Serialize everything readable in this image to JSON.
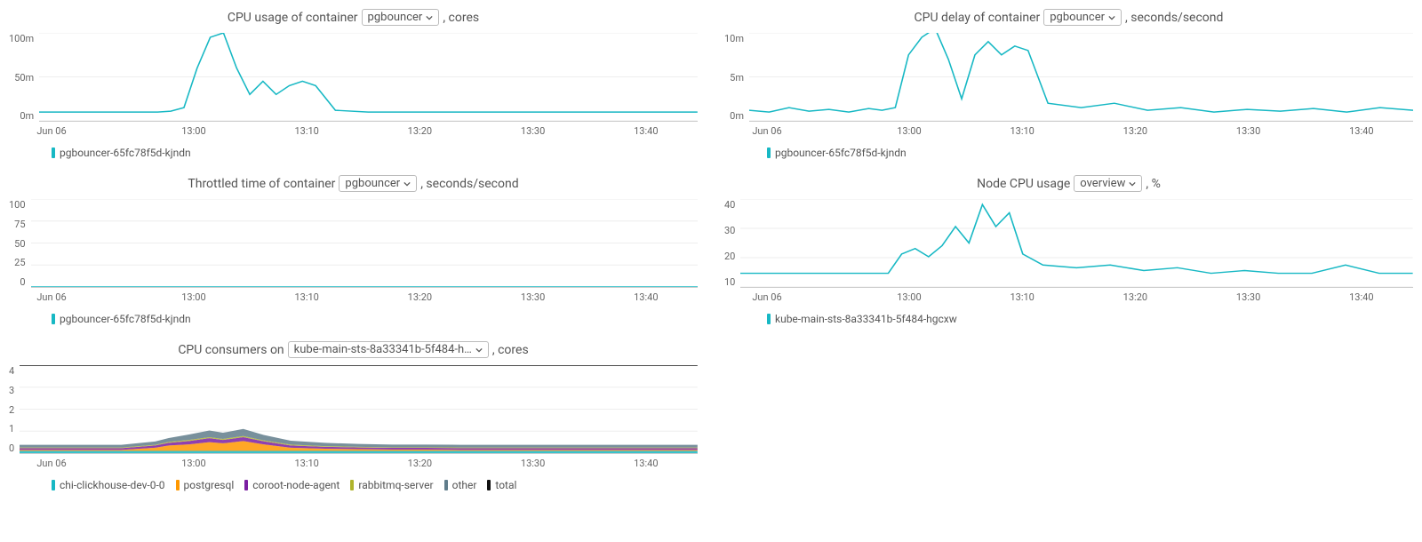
{
  "xticks": [
    "Jun 06",
    "13:00",
    "13:10",
    "13:20",
    "13:30",
    "13:40"
  ],
  "xpositions": [
    0,
    0.22,
    0.395,
    0.57,
    0.745,
    0.92
  ],
  "colors": {
    "teal": "#17b8c4",
    "orange": "#ff9800",
    "purple": "#7b1fa2",
    "olive": "#afb42b",
    "bluegrey": "#607d8b",
    "black": "#111111"
  },
  "panels": [
    {
      "id": "cpu-usage",
      "title_pre": "CPU usage of container",
      "dropdown": "pgbouncer",
      "title_post": ", cores",
      "yticks": [
        "100m",
        "50m",
        "0m"
      ],
      "ymax": 100,
      "legend": [
        {
          "color": "teal",
          "label": "pgbouncer-65fc78f5d-kjndn"
        }
      ]
    },
    {
      "id": "cpu-delay",
      "title_pre": "CPU delay of container",
      "dropdown": "pgbouncer",
      "title_post": ", seconds/second",
      "yticks": [
        "10m",
        "5m",
        "0m"
      ],
      "ymax": 10,
      "legend": [
        {
          "color": "teal",
          "label": "pgbouncer-65fc78f5d-kjndn"
        }
      ]
    },
    {
      "id": "throttled",
      "title_pre": "Throttled time of container",
      "dropdown": "pgbouncer",
      "title_post": ", seconds/second",
      "yticks": [
        "100",
        "75",
        "50",
        "25",
        "0"
      ],
      "ymax": 100,
      "legend": [
        {
          "color": "teal",
          "label": "pgbouncer-65fc78f5d-kjndn"
        }
      ]
    },
    {
      "id": "node-cpu",
      "title_pre": "Node CPU usage",
      "dropdown": "overview",
      "title_post": ", %",
      "yticks": [
        "40",
        "30",
        "20",
        "10"
      ],
      "ymax": 40,
      "ymin": 8,
      "legend": [
        {
          "color": "teal",
          "label": "kube-main-sts-8a33341b-5f484-hgcxw"
        }
      ]
    },
    {
      "id": "consumers",
      "title_pre": "CPU consumers on",
      "dropdown": "kube-main-sts-8a33341b-5f484-h…",
      "title_post": ", cores",
      "yticks": [
        "4",
        "3",
        "2",
        "1",
        "0"
      ],
      "ymax": 4,
      "legend": [
        {
          "color": "teal",
          "label": "chi-clickhouse-dev-0-0"
        },
        {
          "color": "orange",
          "label": "postgresql"
        },
        {
          "color": "purple",
          "label": "coroot-node-agent"
        },
        {
          "color": "olive",
          "label": "rabbitmq-server"
        },
        {
          "color": "bluegrey",
          "label": "other"
        },
        {
          "color": "black",
          "label": "total"
        }
      ]
    }
  ],
  "chart_data": [
    {
      "panel": "cpu-usage",
      "type": "line",
      "xlabel": "",
      "ylabel": "cores",
      "title": "CPU usage of container pgbouncer, cores",
      "ylim": [
        0,
        100
      ],
      "x": [
        0.0,
        0.05,
        0.1,
        0.15,
        0.18,
        0.2,
        0.22,
        0.24,
        0.26,
        0.28,
        0.3,
        0.32,
        0.34,
        0.36,
        0.38,
        0.4,
        0.42,
        0.45,
        0.5,
        0.55,
        0.6,
        0.65,
        0.7,
        0.75,
        0.8,
        0.85,
        0.9,
        0.95,
        1.0
      ],
      "series": [
        {
          "name": "pgbouncer-65fc78f5d-kjndn",
          "values": [
            10,
            10,
            10,
            10,
            10,
            11,
            15,
            60,
            95,
            100,
            60,
            30,
            45,
            30,
            40,
            45,
            40,
            12,
            10,
            10,
            10,
            10,
            10,
            10,
            10,
            10,
            10,
            10,
            10
          ]
        }
      ]
    },
    {
      "panel": "cpu-delay",
      "type": "line",
      "title": "CPU delay of container pgbouncer, seconds/second",
      "ylim": [
        0,
        10
      ],
      "x": [
        0.0,
        0.03,
        0.06,
        0.09,
        0.12,
        0.15,
        0.18,
        0.2,
        0.22,
        0.24,
        0.26,
        0.28,
        0.3,
        0.32,
        0.34,
        0.36,
        0.38,
        0.4,
        0.42,
        0.45,
        0.5,
        0.55,
        0.6,
        0.65,
        0.7,
        0.75,
        0.8,
        0.85,
        0.9,
        0.95,
        1.0
      ],
      "series": [
        {
          "name": "pgbouncer-65fc78f5d-kjndn",
          "values": [
            1.2,
            1.0,
            1.5,
            1.1,
            1.3,
            1.0,
            1.4,
            1.2,
            1.5,
            7.5,
            9.5,
            10.5,
            7.0,
            2.5,
            7.5,
            9.0,
            7.5,
            8.5,
            8.0,
            2.0,
            1.5,
            2.0,
            1.2,
            1.5,
            1.0,
            1.3,
            1.1,
            1.4,
            1.0,
            1.5,
            1.2
          ]
        }
      ]
    },
    {
      "panel": "throttled",
      "type": "line",
      "title": "Throttled time of container pgbouncer, seconds/second",
      "ylim": [
        0,
        100
      ],
      "x": [
        0.0,
        0.5,
        1.0
      ],
      "series": [
        {
          "name": "pgbouncer-65fc78f5d-kjndn",
          "values": [
            0,
            0,
            0
          ]
        }
      ]
    },
    {
      "panel": "node-cpu",
      "type": "line",
      "title": "Node CPU usage overview, %",
      "ylim": [
        8,
        40
      ],
      "x": [
        0.0,
        0.05,
        0.1,
        0.15,
        0.18,
        0.2,
        0.22,
        0.24,
        0.26,
        0.28,
        0.3,
        0.32,
        0.34,
        0.36,
        0.38,
        0.4,
        0.42,
        0.45,
        0.5,
        0.55,
        0.6,
        0.65,
        0.7,
        0.75,
        0.8,
        0.85,
        0.9,
        0.95,
        1.0
      ],
      "series": [
        {
          "name": "kube-main-sts-8a33341b-5f484-hgcxw",
          "values": [
            13,
            13,
            13,
            13,
            13,
            13,
            13,
            20,
            22,
            19,
            23,
            30,
            24,
            38,
            30,
            35,
            20,
            16,
            15,
            16,
            14,
            15,
            13,
            14,
            13,
            13,
            16,
            13,
            13
          ]
        }
      ]
    },
    {
      "panel": "consumers",
      "type": "area",
      "title": "CPU consumers on kube-main-sts-8a33341b-5f484-h…, cores",
      "ylim": [
        0,
        4
      ],
      "x": [
        0.0,
        0.05,
        0.1,
        0.15,
        0.2,
        0.22,
        0.25,
        0.28,
        0.3,
        0.33,
        0.36,
        0.4,
        0.45,
        0.5,
        0.55,
        0.6,
        0.65,
        0.7,
        0.75,
        0.8,
        0.85,
        0.9,
        0.95,
        1.0
      ],
      "total": [
        4,
        4,
        4,
        4,
        4,
        4,
        4,
        4,
        4,
        4,
        4,
        4,
        4,
        4,
        4,
        4,
        4,
        4,
        4,
        4,
        4,
        4,
        4,
        4
      ],
      "series": [
        {
          "name": "chi-clickhouse-dev-0-0",
          "color": "teal",
          "values": [
            0.1,
            0.1,
            0.1,
            0.1,
            0.1,
            0.1,
            0.1,
            0.1,
            0.1,
            0.1,
            0.1,
            0.1,
            0.1,
            0.1,
            0.1,
            0.1,
            0.1,
            0.1,
            0.1,
            0.1,
            0.1,
            0.1,
            0.1,
            0.1
          ]
        },
        {
          "name": "postgresql",
          "color": "orange",
          "values": [
            0.05,
            0.05,
            0.05,
            0.05,
            0.15,
            0.25,
            0.3,
            0.4,
            0.35,
            0.45,
            0.3,
            0.15,
            0.1,
            0.08,
            0.06,
            0.06,
            0.05,
            0.05,
            0.05,
            0.05,
            0.05,
            0.05,
            0.05,
            0.05
          ]
        },
        {
          "name": "coroot-node-agent",
          "color": "purple",
          "values": [
            0.08,
            0.08,
            0.08,
            0.08,
            0.1,
            0.12,
            0.15,
            0.18,
            0.15,
            0.18,
            0.14,
            0.1,
            0.09,
            0.08,
            0.08,
            0.08,
            0.08,
            0.08,
            0.08,
            0.08,
            0.08,
            0.08,
            0.08,
            0.08
          ]
        },
        {
          "name": "rabbitmq-server",
          "color": "olive",
          "values": [
            0.03,
            0.03,
            0.03,
            0.03,
            0.03,
            0.04,
            0.05,
            0.05,
            0.05,
            0.05,
            0.04,
            0.04,
            0.03,
            0.03,
            0.03,
            0.03,
            0.03,
            0.03,
            0.03,
            0.03,
            0.03,
            0.03,
            0.03,
            0.03
          ]
        },
        {
          "name": "other",
          "color": "bluegrey",
          "values": [
            0.12,
            0.12,
            0.12,
            0.12,
            0.15,
            0.18,
            0.25,
            0.3,
            0.28,
            0.32,
            0.25,
            0.18,
            0.15,
            0.13,
            0.12,
            0.12,
            0.12,
            0.12,
            0.12,
            0.12,
            0.12,
            0.12,
            0.12,
            0.12
          ]
        }
      ]
    }
  ]
}
